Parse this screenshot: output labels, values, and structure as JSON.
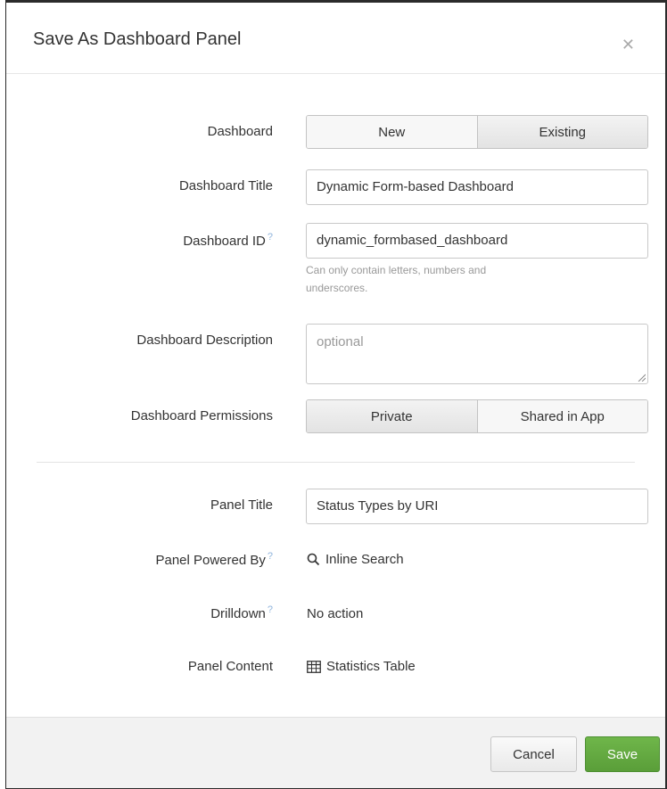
{
  "dialog": {
    "title": "Save As Dashboard Panel",
    "close_icon": "close-icon"
  },
  "form": {
    "dashboard": {
      "label": "Dashboard",
      "options": [
        "New",
        "Existing"
      ],
      "selected": "New"
    },
    "dashboard_title": {
      "label": "Dashboard Title",
      "value": "Dynamic Form-based Dashboard"
    },
    "dashboard_id": {
      "label": "Dashboard ID",
      "help": "?",
      "value": "dynamic_formbased_dashboard",
      "hint_line1": "Can only contain letters, numbers and",
      "hint_line2": "underscores."
    },
    "dashboard_description": {
      "label": "Dashboard Description",
      "placeholder": "optional"
    },
    "dashboard_permissions": {
      "label": "Dashboard Permissions",
      "options": [
        "Private",
        "Shared in App"
      ],
      "selected": "Private"
    },
    "panel_title": {
      "label": "Panel Title",
      "value": "Status Types by URI"
    },
    "panel_powered_by": {
      "label": "Panel Powered By",
      "help": "?",
      "value": "Inline Search",
      "icon": "search-icon"
    },
    "drilldown": {
      "label": "Drilldown",
      "help": "?",
      "value": "No action"
    },
    "panel_content": {
      "label": "Panel Content",
      "value": "Statistics Table",
      "icon": "table-icon"
    }
  },
  "footer": {
    "cancel_label": "Cancel",
    "save_label": "Save"
  },
  "colors": {
    "save_button": "#5fa63e",
    "help_marker": "#8fb4dc"
  }
}
